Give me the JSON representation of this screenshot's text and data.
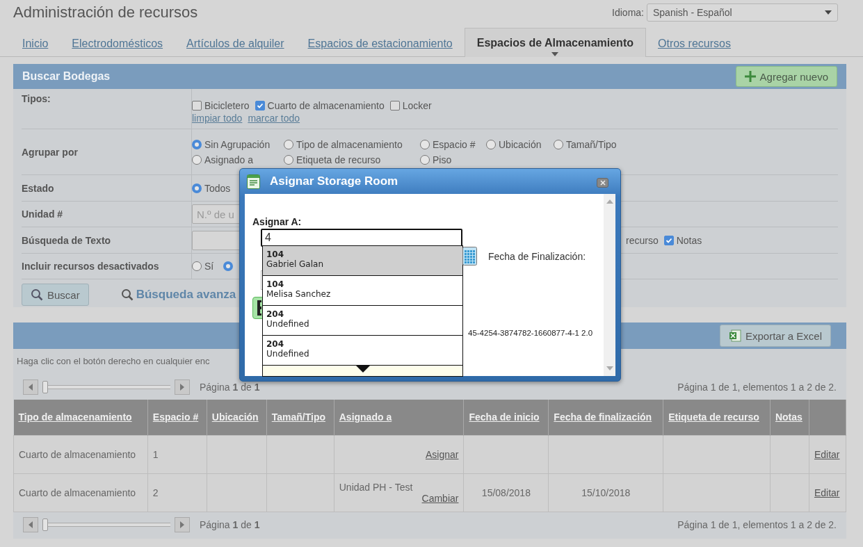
{
  "page": {
    "title": "Administración de recursos",
    "language_label": "Idioma:",
    "language_value": "Spanish - Español"
  },
  "tabs": [
    {
      "label": "Inicio",
      "selected": false
    },
    {
      "label": "Electrodomésticos",
      "selected": false
    },
    {
      "label": "Artículos de alquiler",
      "selected": false
    },
    {
      "label": "Espacios de estacionamiento",
      "selected": false
    },
    {
      "label": "Espacios de Almacenamiento",
      "selected": true
    },
    {
      "label": "Otros recursos",
      "selected": false
    }
  ],
  "search_panel": {
    "title": "Buscar Bodegas",
    "add_button": "Agregar nuevo",
    "types": {
      "label": "Tipos:",
      "options": [
        {
          "label": "Bicicletero",
          "checked": false
        },
        {
          "label": "Cuarto de almacenamiento",
          "checked": true
        },
        {
          "label": "Locker",
          "checked": false
        }
      ],
      "links": [
        "limpiar todo",
        "marcar todo"
      ]
    },
    "group_by": {
      "label": "Agrupar por",
      "options": [
        {
          "label": "Sin Agrupación",
          "selected": true
        },
        {
          "label": "Tipo de almacenamiento",
          "selected": false
        },
        {
          "label": "Espacio #",
          "selected": false
        },
        {
          "label": "Ubicación",
          "selected": false
        },
        {
          "label": "Tamañ/Tipo",
          "selected": false
        },
        {
          "label": "Asignado a",
          "selected": false
        },
        {
          "label": "Etiqueta de recurso",
          "selected": false
        },
        {
          "label": "Piso",
          "selected": false
        }
      ]
    },
    "status": {
      "label": "Estado",
      "options": [
        {
          "label": "Todos",
          "selected": true
        }
      ]
    },
    "unit": {
      "label": "Unidad #",
      "placeholder": "N.º de u"
    },
    "text_search": {
      "label": "Búsqueda de Texto",
      "partial_label": "recurso",
      "options": [
        {
          "label": "Notas",
          "checked": true
        }
      ]
    },
    "include_disabled": {
      "label": "Incluir recursos desactivados",
      "options": [
        {
          "label": "Sí",
          "selected": false
        },
        {
          "selected": true
        }
      ]
    },
    "search_button": "Buscar",
    "advanced_search": "Búsqueda avanza"
  },
  "results": {
    "export_button": "Exportar a Excel",
    "hint": "Haga clic con el botón derecho en cualquier enc",
    "pager_top": {
      "page": "Página **1** de **1**",
      "summary": "Página 1 de 1, elementos 1 a 2 de 2.",
      "level": 0
    },
    "columns": [
      "Tipo de almacenamiento",
      "Espacio #",
      "Ubicación",
      "Tamañ/Tipo",
      "Asignado a",
      "Fecha de inicio",
      "Fecha de finalización",
      "Etiqueta de recurso",
      "Notas"
    ],
    "rows": [
      {
        "type": "Cuarto de almacenamiento",
        "space": "1",
        "action": "Asignar",
        "edit": "Editar"
      },
      {
        "type": "Cuarto de almacenamiento",
        "space": "2",
        "assigned_to": "Unidad PH - Test",
        "action": "Cambiar",
        "start": "15/08/2018",
        "end": "15/10/2018",
        "edit": "Editar"
      }
    ],
    "pager_bottom": {
      "page": "Página **1** de **1**",
      "summary": "Página 1 de 1, elementos 1 a 2 de 2.",
      "level": 0
    }
  },
  "dialog": {
    "title": "Asignar Storage Room",
    "assign_label": "Asignar A:",
    "assign_value": "4",
    "suggestions": [
      {
        "number": "104",
        "name": "Gabriel Galan",
        "selected": true
      },
      {
        "number": "104",
        "name": "Melisa Sanchez",
        "selected": false
      },
      {
        "number": "204",
        "name": "Undefined",
        "selected": false
      },
      {
        "number": "204",
        "name": "Undefined",
        "selected": false
      }
    ],
    "end_date_label": "Fecha de Finalización:",
    "code": "45-4254-3874782-1660877-4-1 2.0"
  }
}
